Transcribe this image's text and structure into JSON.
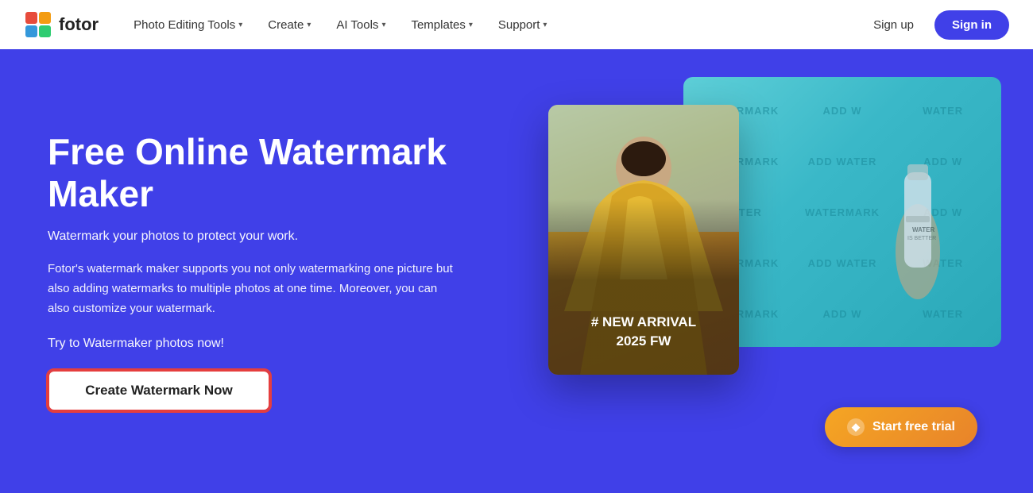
{
  "navbar": {
    "logo_text": "fotor",
    "nav_items": [
      {
        "label": "Photo Editing Tools",
        "has_chevron": true
      },
      {
        "label": "Create",
        "has_chevron": true
      },
      {
        "label": "AI Tools",
        "has_chevron": true
      },
      {
        "label": "Templates",
        "has_chevron": true
      },
      {
        "label": "Support",
        "has_chevron": true
      }
    ],
    "signup_label": "Sign up",
    "signin_label": "Sign in"
  },
  "hero": {
    "title": "Free Online Watermark Maker",
    "subtitle": "Watermark your photos to protect your work.",
    "description": "Fotor's watermark maker supports you not only watermarking one picture but also adding watermarks to multiple photos at one time. Moreover, you can also customize your watermark.",
    "cta_text": "Try to Watermaker photos now!",
    "create_btn_label": "Create Watermark Now",
    "trial_btn_label": "Start free trial",
    "card_label_line1": "# NEW ARRIVAL",
    "card_label_line2": "2025 FW"
  },
  "watermark_bg_texts": [
    "WATERMARK",
    "ADD W",
    "WATER",
    "ADD WATER",
    "WATERMARK",
    "ADD W",
    "WATERMARK",
    "ADD W",
    "WATER",
    "ADD WATER",
    "WATERMARK",
    "ADD W",
    "WATERMARK",
    "ADD W",
    "WATER"
  ]
}
